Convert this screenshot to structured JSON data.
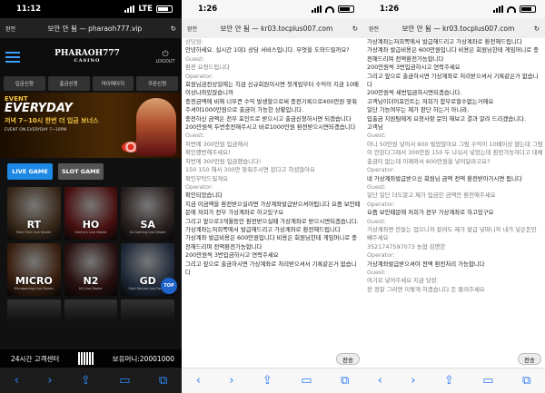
{
  "phone1": {
    "time": "11:12",
    "network": "LTE",
    "address_label": "완전",
    "url": "보안 안 됨 — pharaoh777.vip",
    "logo_title": "PHARAOH777",
    "logo_sub": "CASINO",
    "logout": "LOGOUT",
    "nav_tabs": [
      "입금신청",
      "출금신청",
      "마이페이지",
      "쿠폰신청"
    ],
    "banner": {
      "event": "EVENT",
      "headline": "EVERYDAY",
      "sub": "저녁 7~10시 한번 더 입금 보너스",
      "fine": "EVENT ON EVERYDAY 7~10PM"
    },
    "live_button": "LIVE GAME",
    "slot_button": "SLOT GAME",
    "tiles": [
      {
        "name": "RT",
        "sub": "Real Time Live Dealer",
        "color": "#3a2a1a"
      },
      {
        "name": "HO",
        "sub": "Hold'em Live Dealer",
        "color": "#4a1010"
      },
      {
        "name": "SA",
        "sub": "SA Gaming Live Dealer",
        "color": "#2a2020"
      },
      {
        "name": "MICRO",
        "sub": "Microgaming Live Dealer",
        "color": "#3a2010"
      },
      {
        "name": "N2",
        "sub": "N2 Live Dealer",
        "color": "#2a1010"
      },
      {
        "name": "GD",
        "sub": "Gold Deluxe Live Dealer",
        "color": "#202a3a"
      }
    ],
    "top_button": "TOP",
    "footer_support": "24시간 고객센터",
    "footer_balance": "보유머니:20001000",
    "colors": {
      "live_button": "#1e88e5",
      "slot_button": "#555555"
    }
  },
  "phone2": {
    "time": "1:26",
    "address_label": "완전",
    "url": "보안 안 됨 — kr03.tocplus007.com",
    "lines": [
      {
        "text": "상담원:",
        "cls": "role"
      },
      {
        "text": "안녕하세요. 실시간 1대1 상담 서비스입니다. 무엇을 도와드릴까요?",
        "cls": ""
      },
      {
        "text": "Guest:",
        "cls": "role"
      },
      {
        "text": "환전 요청드립니다",
        "cls": "gst"
      },
      {
        "text": "Operator:",
        "cls": "role"
      },
      {
        "text": "회원님금전상일에는 지금 신규회원이시면 첫게임부터 수익이 지금 10배이상나와있잖습니까",
        "cls": ""
      },
      {
        "text": "충전금액에 비해 너무큰 수익 발생할으로써 충전기록으로400만원 맞춰주셔야1000만원으로 출금이 가능한 상황입니다.",
        "cls": ""
      },
      {
        "text": "충전하신 금액은 전부 포인트로 받으시고 출금신청하시면 되겠습니다",
        "cls": ""
      },
      {
        "text": "200만원씩 두번충전해주시고 바로1000만원 환전받으시면되겠습니다",
        "cls": ""
      },
      {
        "text": "Guest:",
        "cls": "role"
      },
      {
        "text": "처번에 300만원 입금해서",
        "cls": "gst"
      },
      {
        "text": "확인했번해주세요!",
        "cls": "gst"
      },
      {
        "text": "처번에 300만원 입금했습니다!",
        "cls": "gst"
      },
      {
        "text": "150 150 해서 300만 맞춰주시면 된다고 하셨잖아요",
        "cls": "gst"
      },
      {
        "text": "확인부탁드릴게요",
        "cls": "gst"
      },
      {
        "text": "Operator:",
        "cls": "role"
      },
      {
        "text": "확인되었습니다",
        "cls": ""
      },
      {
        "text": "지금 이금액을 환전받으실려면 가상계좌발급받으셔야됩니다 요즘 보안때문에 저희가 전부 가상계좌로 하고있구요",
        "cls": ""
      },
      {
        "text": "그리고 앞으로3개월동안 환전받으실때 가상계좌로 받으시면되겠습니다.",
        "cls": ""
      },
      {
        "text": "가상계좌는저희쪽에서 발급해드리고 가상계좌로 환전해드립니다",
        "cls": ""
      },
      {
        "text": "가상계좌 발급비용은 600만원입니다 비용은 회원님한테 게임머니로 충전해드리며 전액환전가능합니다",
        "cls": ""
      },
      {
        "text": "200만원씩 3번입금하시고 연락주세요",
        "cls": ""
      },
      {
        "text": "그리고 앞으로 출금하시면 가상계좌로 처리받으셔서 기록같은거 없습니다",
        "cls": ""
      }
    ],
    "send_label": "전송"
  },
  "phone3": {
    "time": "1:26",
    "address_label": "완전",
    "url": "보안 안 됨 — kr03.tocplus007.com",
    "lines": [
      {
        "text": "가상계좌는저희쪽에서 발급해드리고 가상계좌로 환전해드립니다",
        "cls": ""
      },
      {
        "text": "가상계좌 발급비용은 600만원입니다 비용은 회원님한테 게임머니로 충전해드리며 전액환전가능합니다",
        "cls": ""
      },
      {
        "text": "200만원씩 3번입금하시고 연락주세요",
        "cls": ""
      },
      {
        "text": "그리고 앞으로 출금하시면 가상계좌로 처리받으셔서 기록같은거 없습니다",
        "cls": ""
      },
      {
        "text": "200만원씩 세번입금하시면되겠습니다.",
        "cls": ""
      },
      {
        "text": "고객님이더이포인트는 저희가 함부로할수없는거에요",
        "cls": ""
      },
      {
        "text": "일단 가능여부는 제가 판단 하는거 아니라,",
        "cls": ""
      },
      {
        "text": "입출금 지원팀에게 요청사항 문의 해보고 결과 알려 드리겠습니다.",
        "cls": ""
      },
      {
        "text": "고객님",
        "cls": ""
      },
      {
        "text": "Guest:",
        "cls": "role"
      },
      {
        "text": "아니 50만원 넣어서 600 벌었잖아요 그럼 수익이 10배이상 됐는데 그럼 이 안된다그래서 300만원 150 두 나눠서 넣었는데 환전가능하다고 대체 출금이 없는데 이제와서 600만원을 넣어달라고요?",
        "cls": "gst"
      },
      {
        "text": "Operator:",
        "cls": "role"
      },
      {
        "text": "네 가상계좌발급받으신 회원님 금액 전액 환전받아가시면 됩니다",
        "cls": ""
      },
      {
        "text": "Guest:",
        "cls": "role"
      },
      {
        "text": "일단 일단 더도말고 제가 입금한 금액만 환전해주세요",
        "cls": "gst"
      },
      {
        "text": "Operator:",
        "cls": "role"
      },
      {
        "text": "요즘 보안때문에 저희가 전부 가상계좌로 하고있구요",
        "cls": ""
      },
      {
        "text": "Guest:",
        "cls": "role"
      },
      {
        "text": "가상계좌면 만들는 업으니까 잘려도 제가 발급 넣떠니까 내가 넣은돈만 빼주세요",
        "cls": "gst"
      },
      {
        "text": "3521747597073 농협 김명한",
        "cls": "gst"
      },
      {
        "text": "Operator:",
        "cls": "role"
      },
      {
        "text": "가상계좌발급받으셔야 전액 환전처리 가능합니다",
        "cls": ""
      },
      {
        "text": "Guest:",
        "cls": "role"
      },
      {
        "text": "여기로 넣어주세요 지금 당장.",
        "cls": "gst"
      },
      {
        "text": "전 정말 그러면 이렇게 하겠습니다 돈 돌려주세요",
        "cls": "gst"
      }
    ],
    "send_label": "전송"
  }
}
